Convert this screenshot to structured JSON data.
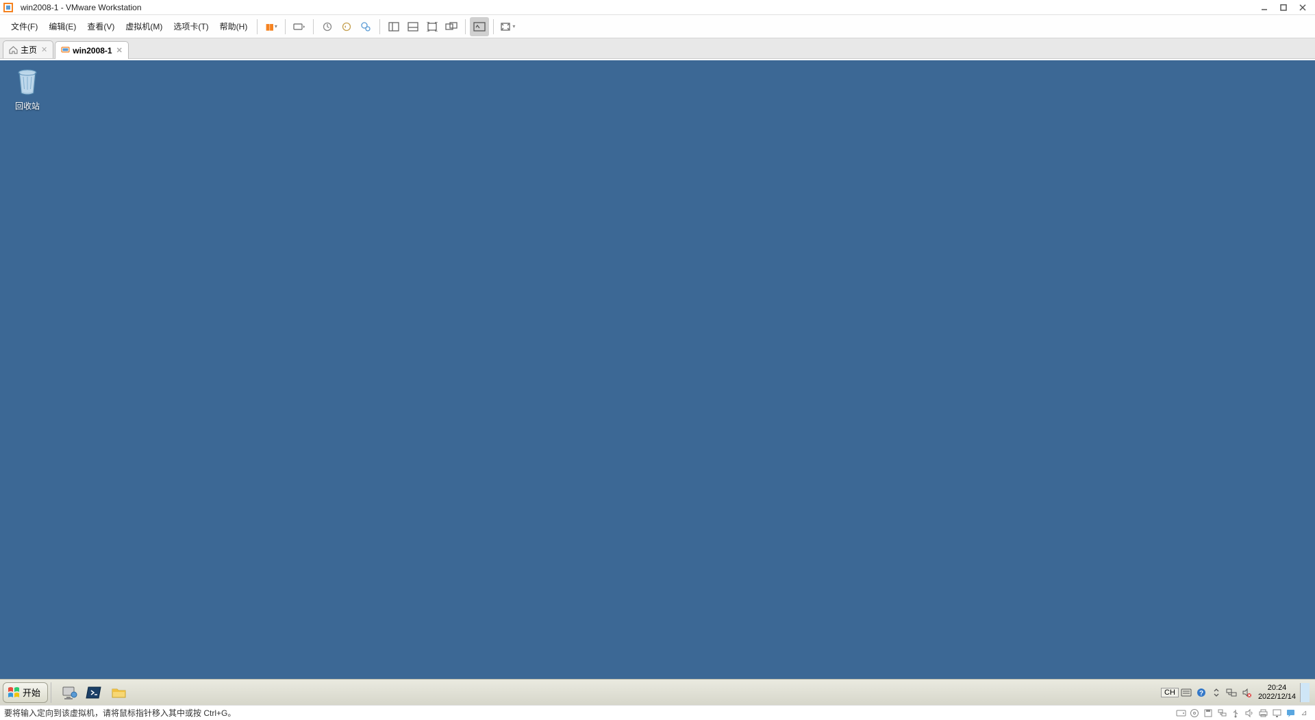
{
  "app": {
    "title": "win2008-1 - VMware Workstation"
  },
  "menu": {
    "file": "文件(F)",
    "edit": "编辑(E)",
    "view": "查看(V)",
    "vm": "虚拟机(M)",
    "tabs": "选项卡(T)",
    "help": "帮助(H)"
  },
  "tabs": {
    "home": "主页",
    "vm": "win2008-1"
  },
  "guest": {
    "recycle_bin": "回收站",
    "start": "开始",
    "lang": "CH",
    "time": "20:24",
    "date": "2022/12/14"
  },
  "status": {
    "hint": "要将输入定向到该虚拟机，请将鼠标指针移入其中或按 Ctrl+G。"
  }
}
